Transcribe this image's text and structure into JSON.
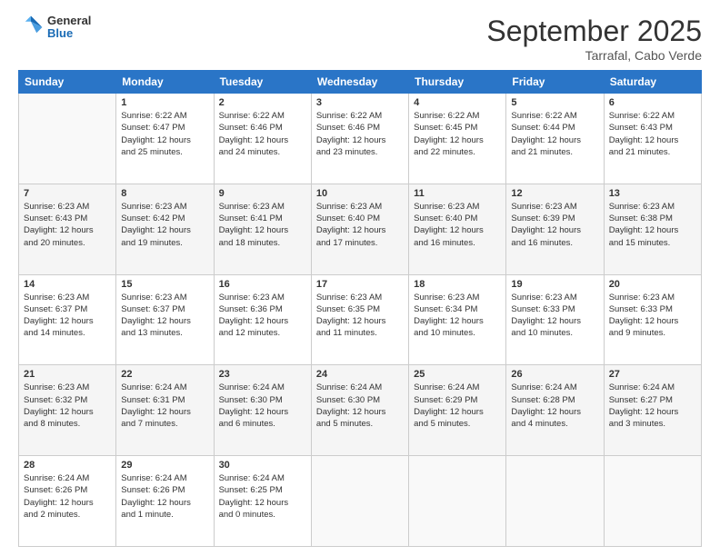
{
  "header": {
    "logo": {
      "general": "General",
      "blue": "Blue"
    },
    "title": "September 2025",
    "subtitle": "Tarrafal, Cabo Verde"
  },
  "days_of_week": [
    "Sunday",
    "Monday",
    "Tuesday",
    "Wednesday",
    "Thursday",
    "Friday",
    "Saturday"
  ],
  "weeks": [
    [
      {
        "day": "",
        "info": ""
      },
      {
        "day": "1",
        "info": "Sunrise: 6:22 AM\nSunset: 6:47 PM\nDaylight: 12 hours\nand 25 minutes."
      },
      {
        "day": "2",
        "info": "Sunrise: 6:22 AM\nSunset: 6:46 PM\nDaylight: 12 hours\nand 24 minutes."
      },
      {
        "day": "3",
        "info": "Sunrise: 6:22 AM\nSunset: 6:46 PM\nDaylight: 12 hours\nand 23 minutes."
      },
      {
        "day": "4",
        "info": "Sunrise: 6:22 AM\nSunset: 6:45 PM\nDaylight: 12 hours\nand 22 minutes."
      },
      {
        "day": "5",
        "info": "Sunrise: 6:22 AM\nSunset: 6:44 PM\nDaylight: 12 hours\nand 21 minutes."
      },
      {
        "day": "6",
        "info": "Sunrise: 6:22 AM\nSunset: 6:43 PM\nDaylight: 12 hours\nand 21 minutes."
      }
    ],
    [
      {
        "day": "7",
        "info": "Sunrise: 6:23 AM\nSunset: 6:43 PM\nDaylight: 12 hours\nand 20 minutes."
      },
      {
        "day": "8",
        "info": "Sunrise: 6:23 AM\nSunset: 6:42 PM\nDaylight: 12 hours\nand 19 minutes."
      },
      {
        "day": "9",
        "info": "Sunrise: 6:23 AM\nSunset: 6:41 PM\nDaylight: 12 hours\nand 18 minutes."
      },
      {
        "day": "10",
        "info": "Sunrise: 6:23 AM\nSunset: 6:40 PM\nDaylight: 12 hours\nand 17 minutes."
      },
      {
        "day": "11",
        "info": "Sunrise: 6:23 AM\nSunset: 6:40 PM\nDaylight: 12 hours\nand 16 minutes."
      },
      {
        "day": "12",
        "info": "Sunrise: 6:23 AM\nSunset: 6:39 PM\nDaylight: 12 hours\nand 16 minutes."
      },
      {
        "day": "13",
        "info": "Sunrise: 6:23 AM\nSunset: 6:38 PM\nDaylight: 12 hours\nand 15 minutes."
      }
    ],
    [
      {
        "day": "14",
        "info": "Sunrise: 6:23 AM\nSunset: 6:37 PM\nDaylight: 12 hours\nand 14 minutes."
      },
      {
        "day": "15",
        "info": "Sunrise: 6:23 AM\nSunset: 6:37 PM\nDaylight: 12 hours\nand 13 minutes."
      },
      {
        "day": "16",
        "info": "Sunrise: 6:23 AM\nSunset: 6:36 PM\nDaylight: 12 hours\nand 12 minutes."
      },
      {
        "day": "17",
        "info": "Sunrise: 6:23 AM\nSunset: 6:35 PM\nDaylight: 12 hours\nand 11 minutes."
      },
      {
        "day": "18",
        "info": "Sunrise: 6:23 AM\nSunset: 6:34 PM\nDaylight: 12 hours\nand 10 minutes."
      },
      {
        "day": "19",
        "info": "Sunrise: 6:23 AM\nSunset: 6:33 PM\nDaylight: 12 hours\nand 10 minutes."
      },
      {
        "day": "20",
        "info": "Sunrise: 6:23 AM\nSunset: 6:33 PM\nDaylight: 12 hours\nand 9 minutes."
      }
    ],
    [
      {
        "day": "21",
        "info": "Sunrise: 6:23 AM\nSunset: 6:32 PM\nDaylight: 12 hours\nand 8 minutes."
      },
      {
        "day": "22",
        "info": "Sunrise: 6:24 AM\nSunset: 6:31 PM\nDaylight: 12 hours\nand 7 minutes."
      },
      {
        "day": "23",
        "info": "Sunrise: 6:24 AM\nSunset: 6:30 PM\nDaylight: 12 hours\nand 6 minutes."
      },
      {
        "day": "24",
        "info": "Sunrise: 6:24 AM\nSunset: 6:30 PM\nDaylight: 12 hours\nand 5 minutes."
      },
      {
        "day": "25",
        "info": "Sunrise: 6:24 AM\nSunset: 6:29 PM\nDaylight: 12 hours\nand 5 minutes."
      },
      {
        "day": "26",
        "info": "Sunrise: 6:24 AM\nSunset: 6:28 PM\nDaylight: 12 hours\nand 4 minutes."
      },
      {
        "day": "27",
        "info": "Sunrise: 6:24 AM\nSunset: 6:27 PM\nDaylight: 12 hours\nand 3 minutes."
      }
    ],
    [
      {
        "day": "28",
        "info": "Sunrise: 6:24 AM\nSunset: 6:26 PM\nDaylight: 12 hours\nand 2 minutes."
      },
      {
        "day": "29",
        "info": "Sunrise: 6:24 AM\nSunset: 6:26 PM\nDaylight: 12 hours\nand 1 minute."
      },
      {
        "day": "30",
        "info": "Sunrise: 6:24 AM\nSunset: 6:25 PM\nDaylight: 12 hours\nand 0 minutes."
      },
      {
        "day": "",
        "info": ""
      },
      {
        "day": "",
        "info": ""
      },
      {
        "day": "",
        "info": ""
      },
      {
        "day": "",
        "info": ""
      }
    ]
  ]
}
